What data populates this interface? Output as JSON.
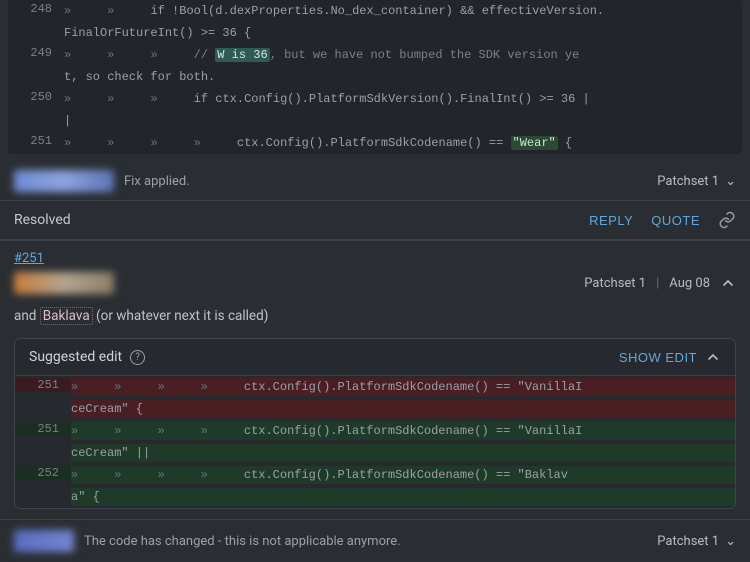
{
  "top_code": {
    "lines": [
      {
        "num": "248",
        "prefix_arrows": 2,
        "text": "if !Bool(d.dexProperties.No_dex_container) && effectiveVersion."
      },
      {
        "num": "",
        "prefix_arrows": 0,
        "text": "FinalOrFutureInt() >= 36 {"
      },
      {
        "num": "249",
        "prefix_arrows": 3,
        "comment": true,
        "pre": "// ",
        "hl": "W is 36",
        "post": ", but we have not bumped the SDK version ye"
      },
      {
        "num": "",
        "prefix_arrows": 0,
        "text": "t, so check for both."
      },
      {
        "num": "250",
        "prefix_arrows": 3,
        "text": "if ctx.Config().PlatformSdkVersion().FinalInt() >= 36 |"
      },
      {
        "num": "",
        "prefix_arrows": 0,
        "text": "|"
      },
      {
        "num": "251",
        "prefix_arrows": 4,
        "pre": "ctx.Config().PlatformSdkCodename() == ",
        "hl2": "\"Wear\"",
        "post": " {"
      }
    ]
  },
  "fix_row": {
    "status": "Fix applied.",
    "patchset": "Patchset 1"
  },
  "resolve_row": {
    "label": "Resolved",
    "reply": "REPLY",
    "quote": "QUOTE"
  },
  "anchor": "#251",
  "comment_head": {
    "patchset": "Patchset 1",
    "date": "Aug 08"
  },
  "comment_body": {
    "pre": "and ",
    "baklava": "Baklava",
    "post": " (or whatever next it is called)"
  },
  "suggest": {
    "title": "Suggested edit",
    "show": "SHOW EDIT",
    "lines": [
      {
        "kind": "remove",
        "num": "251",
        "prefix_arrows": 4,
        "text": "ctx.Config().PlatformSdkCodename() == \"VanillaI"
      },
      {
        "kind": "remove",
        "num": "",
        "prefix_arrows": 0,
        "text": "ceCream\" {"
      },
      {
        "kind": "add",
        "num": "251",
        "prefix_arrows": 4,
        "text": "ctx.Config().PlatformSdkCodename() == \"VanillaI"
      },
      {
        "kind": "add",
        "num": "",
        "prefix_arrows": 0,
        "text": "ceCream\" ||"
      },
      {
        "kind": "add",
        "num": "252",
        "prefix_arrows": 4,
        "text": "ctx.Config().PlatformSdkCodename() == \"Baklav"
      },
      {
        "kind": "add",
        "num": "",
        "prefix_arrows": 0,
        "text": "a\" {"
      }
    ]
  },
  "bottom_row": {
    "text": "The code has changed - this is not applicable anymore.",
    "patchset": "Patchset 1"
  },
  "glyphs": {
    "arrow": "»",
    "chev_down": "⌄",
    "chev_up": "⌃"
  }
}
